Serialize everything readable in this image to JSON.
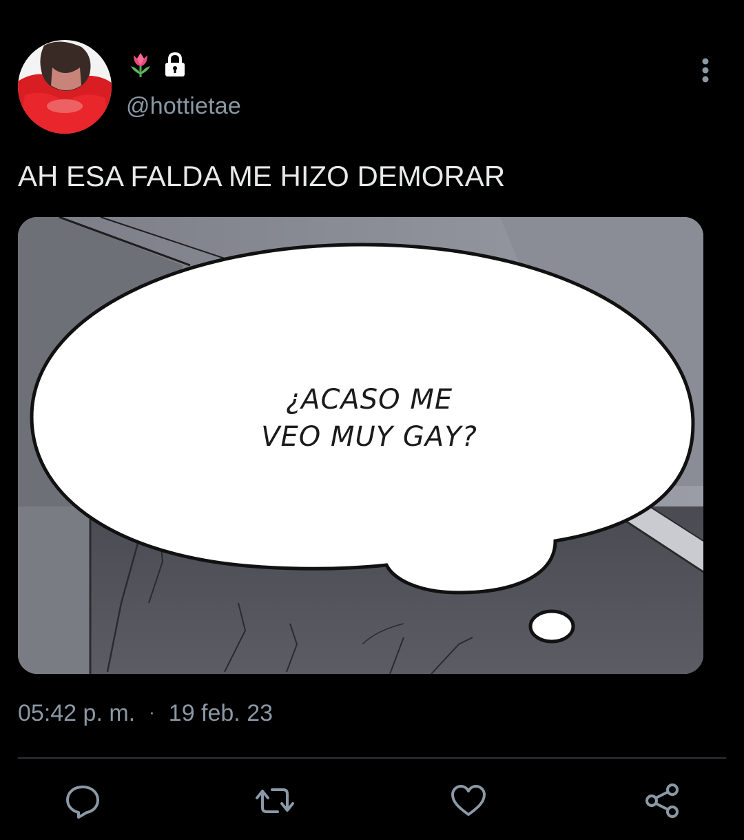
{
  "tweet": {
    "display_name_icons": [
      "tulip-emoji",
      "lock-icon"
    ],
    "handle": "@hottietae",
    "text": "AH ESA FALDA ME HIZO DEMORAR",
    "time": "05:42 p. m.",
    "separator": "·",
    "date": "19 feb. 23"
  },
  "media": {
    "speech_bubble_lines": [
      "¿ACASO ME",
      "VEO MUY GAY?"
    ]
  },
  "actions": [
    "reply-icon",
    "retweet-icon",
    "like-icon",
    "share-icon"
  ],
  "colors": {
    "background": "#000000",
    "text_primary": "#e7e9ea",
    "text_secondary": "#8b98a5",
    "divider": "#2f3336",
    "icon": "#8b98a5"
  }
}
